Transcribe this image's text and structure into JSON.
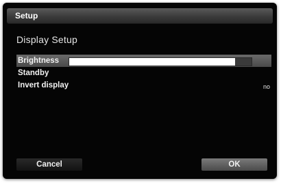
{
  "window": {
    "title": "Setup"
  },
  "section": {
    "title": "Display Setup"
  },
  "settings": [
    {
      "label": "Brightness",
      "value": "",
      "slider_level": 0.91
    },
    {
      "label": "Standby",
      "value": ""
    },
    {
      "label": "Invert display",
      "value": "no"
    }
  ],
  "buttons": {
    "cancel": "Cancel",
    "ok": "OK"
  },
  "colors": {
    "background": "#050505",
    "selection": "#5a5a5a",
    "slider_fill": "#ffffff"
  }
}
